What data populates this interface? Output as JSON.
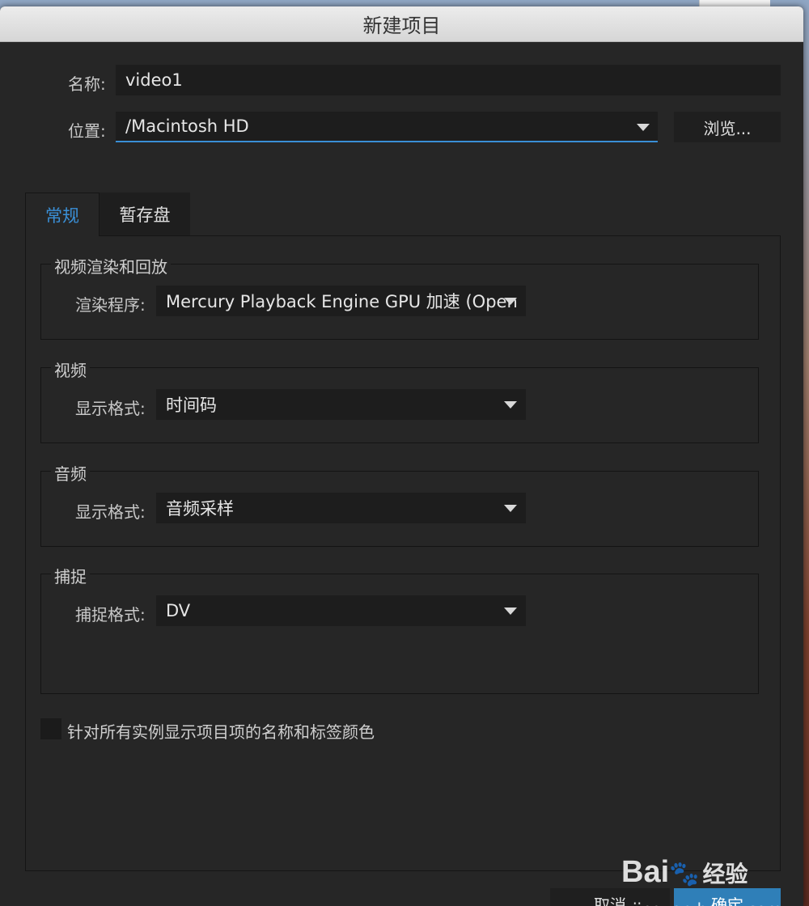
{
  "dialog": {
    "title": "新建项目",
    "name_label": "名称:",
    "name_value": "video1",
    "location_label": "位置:",
    "location_value": "/Macintosh HD",
    "browse_label": "浏览..."
  },
  "tabs": [
    {
      "label": "常规",
      "active": true
    },
    {
      "label": "暂存盘",
      "active": false
    }
  ],
  "groups": {
    "render": {
      "title": "视频渲染和回放",
      "field_label": "渲染程序:",
      "field_value": "Mercury Playback Engine GPU 加速 (Open"
    },
    "video": {
      "title": "视频",
      "field_label": "显示格式:",
      "field_value": "时间码"
    },
    "audio": {
      "title": "音频",
      "field_label": "显示格式:",
      "field_value": "音频采样"
    },
    "capture": {
      "title": "捕捉",
      "field_label": "捕捉格式:",
      "field_value": "DV"
    }
  },
  "checkbox": {
    "label": "针对所有实例显示项目项的名称和标签颜色",
    "checked": false
  },
  "footer": {
    "cancel_label": "取消",
    "ok_label": "确定"
  },
  "watermark": {
    "brand": "Bai",
    "brand2": "经验",
    "site": "jingyan.baidu.com"
  },
  "colors": {
    "accent": "#3a8fd6",
    "primary_button": "#2f7fb8"
  }
}
